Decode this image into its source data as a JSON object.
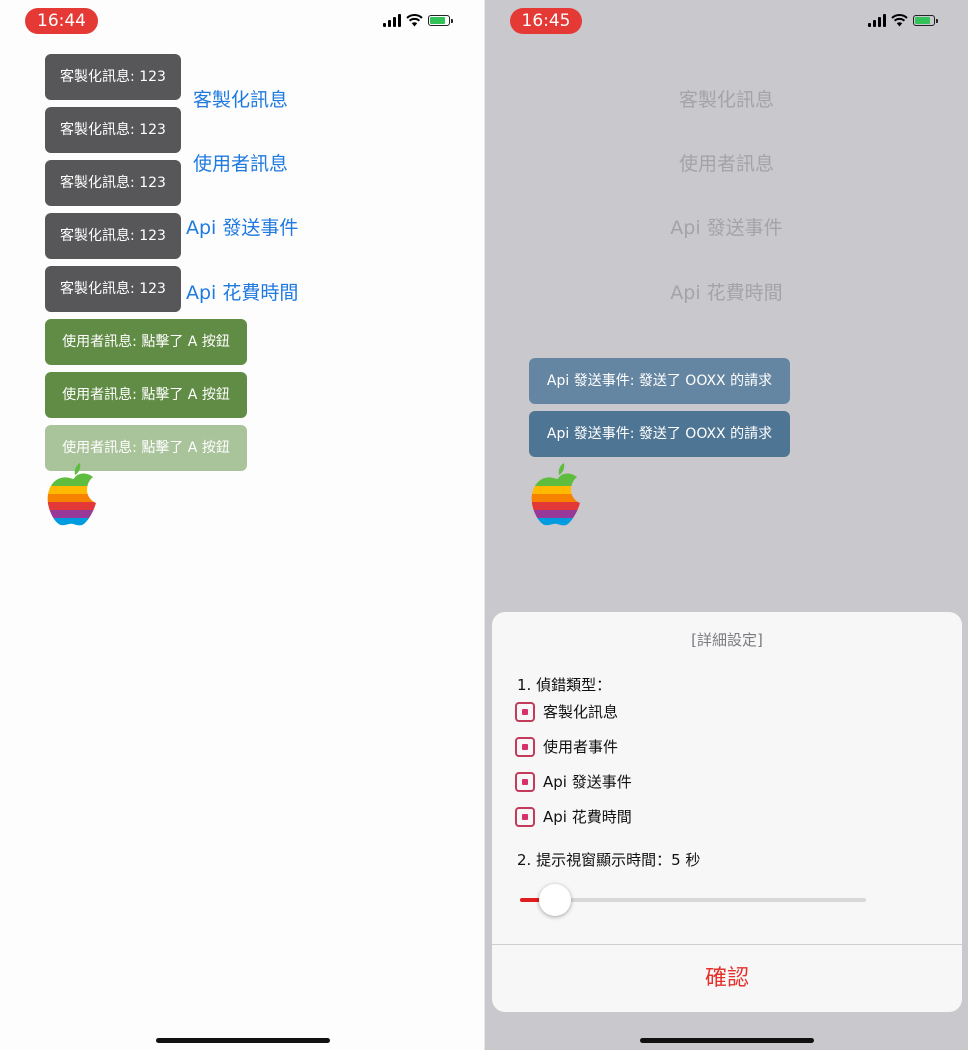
{
  "left_screen": {
    "status_time": "16:44",
    "toasts": [
      {
        "text": "客製化訊息: 123",
        "kind": "custom"
      },
      {
        "text": "客製化訊息: 123",
        "kind": "custom"
      },
      {
        "text": "客製化訊息: 123",
        "kind": "custom"
      },
      {
        "text": "客製化訊息: 123",
        "kind": "custom"
      },
      {
        "text": "客製化訊息: 123",
        "kind": "custom"
      },
      {
        "text": "使用者訊息: 點擊了 A 按鈕",
        "kind": "user"
      },
      {
        "text": "使用者訊息: 點擊了 A 按鈕",
        "kind": "user"
      },
      {
        "text": "使用者訊息: 點擊了 A 按鈕",
        "kind": "user-fading"
      }
    ],
    "buttons": [
      "客製化訊息",
      "使用者訊息",
      "Api 發送事件",
      "Api 花費時間"
    ]
  },
  "right_screen": {
    "status_time": "16:45",
    "buttons": [
      "客製化訊息",
      "使用者訊息",
      "Api 發送事件",
      "Api 花費時間"
    ],
    "toasts": [
      {
        "text": "Api 發送事件: 發送了 OOXX 的請求",
        "kind": "api-light"
      },
      {
        "text": "Api 發送事件: 發送了 OOXX 的請求",
        "kind": "api"
      }
    ],
    "sheet": {
      "title": "[詳細設定]",
      "section1_label": "1. 偵錯類型：",
      "options": [
        {
          "label": "客製化訊息",
          "checked": true
        },
        {
          "label": "使用者事件",
          "checked": true
        },
        {
          "label": "Api 發送事件",
          "checked": true
        },
        {
          "label": "Api 花費時間",
          "checked": true
        }
      ],
      "section2_label": "2. 提示視窗顯示時間：5 秒",
      "slider_fraction": 0.1,
      "confirm_label": "確認"
    }
  },
  "colors": {
    "time_pill": "#e53935",
    "link_blue": "#1f7ae0",
    "custom_toast": "#575759",
    "user_toast": "#618c45",
    "api_toast": "#4e7594",
    "checkbox": "#c43a5b",
    "confirm_red": "#e4312b",
    "slider_fill": "#e01e1e"
  },
  "icons": [
    "signal-icon",
    "wifi-icon",
    "battery-charging-icon",
    "apple-rainbow-logo"
  ]
}
